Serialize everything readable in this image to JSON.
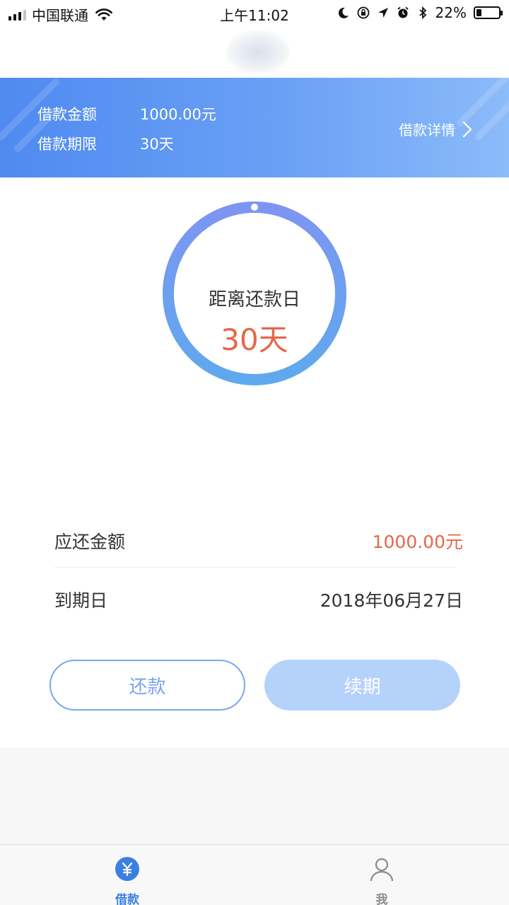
{
  "status_bar": {
    "carrier": "中国联通",
    "time": "上午11:02",
    "battery": "22%"
  },
  "loan_summary": {
    "amount_label": "借款金额",
    "amount_value": "1000.00元",
    "term_label": "借款期限",
    "term_value": "30天",
    "detail_link": "借款详情"
  },
  "countdown": {
    "label": "距离还款日",
    "days": "30天"
  },
  "repayment": {
    "due_amount_label": "应还金额",
    "due_amount_value": "1000.00元",
    "due_date_label": "到期日",
    "due_date_value": "2018年06月27日"
  },
  "actions": {
    "repay_label": "还款",
    "renew_label": "续期"
  },
  "tab_bar": {
    "tabs": [
      {
        "label": "借款",
        "icon": "yuan-coin-icon",
        "active": true
      },
      {
        "label": "我",
        "icon": "person-icon",
        "active": false
      }
    ]
  },
  "colors": {
    "accent_blue": "#4f8af0",
    "highlight_red": "#e5674a",
    "tab_active": "#3b7fe2",
    "tab_inactive": "#8a8a8a"
  }
}
